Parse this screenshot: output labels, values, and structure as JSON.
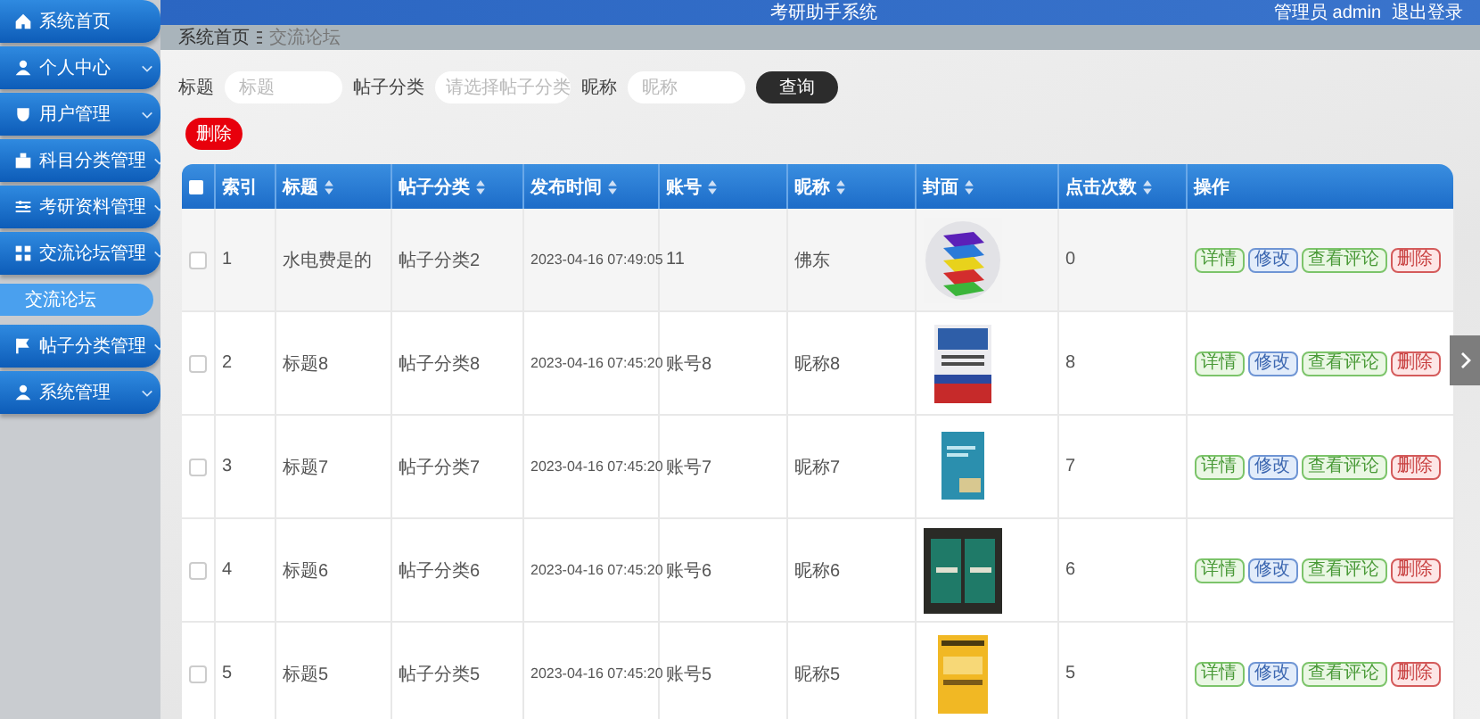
{
  "sidebar": {
    "items": [
      {
        "label": "系统首页",
        "kind": "link"
      },
      {
        "label": "个人中心",
        "kind": "menu"
      },
      {
        "label": "用户管理",
        "kind": "menu"
      },
      {
        "label": "科目分类管理",
        "kind": "menu"
      },
      {
        "label": "考研资料管理",
        "kind": "menu"
      },
      {
        "label": "交流论坛管理",
        "kind": "menu",
        "children": [
          {
            "label": "交流论坛",
            "selected": true
          }
        ]
      },
      {
        "label": "帖子分类管理",
        "kind": "menu"
      },
      {
        "label": "系统管理",
        "kind": "menu"
      }
    ]
  },
  "header": {
    "title": "考研助手系统",
    "user": "管理员 admin",
    "logout": "退出登录"
  },
  "breadcrumb": [
    "系统首页",
    "交流论坛"
  ],
  "search": {
    "fields": [
      {
        "label": "标题",
        "kind": "input",
        "placeholder": "标题"
      },
      {
        "label": "帖子分类",
        "kind": "select",
        "placeholder": "请选择帖子分类"
      },
      {
        "label": "昵称",
        "kind": "input",
        "placeholder": "昵称"
      }
    ],
    "button": "查询"
  },
  "delete_button": "删除",
  "table": {
    "header_checked": false,
    "columns": [
      {
        "label": "索引",
        "sortable": false
      },
      {
        "label": "标题",
        "sortable": true
      },
      {
        "label": "帖子分类",
        "sortable": true
      },
      {
        "label": "发布时间",
        "sortable": true
      },
      {
        "label": "账号",
        "sortable": true
      },
      {
        "label": "昵称",
        "sortable": true
      },
      {
        "label": "封面",
        "sortable": true
      },
      {
        "label": "点击次数",
        "sortable": true
      },
      {
        "label": "操作",
        "sortable": false
      }
    ],
    "rows": [
      {
        "checked": false,
        "index": "1",
        "title": "水电费是的",
        "category": "帖子分类2",
        "time": "2023-04-16 07:49:05",
        "account": "11",
        "nickname": "佛东",
        "cover": {
          "kind": "picture"
        },
        "clicks": "0",
        "actions": [
          {
            "label": "详情",
            "kind": "detail"
          },
          {
            "label": "修改",
            "kind": "edit"
          },
          {
            "label": "查看评论",
            "kind": "comments"
          },
          {
            "label": "删除",
            "kind": "delete"
          }
        ]
      },
      {
        "checked": false,
        "index": "2",
        "title": "标题8",
        "category": "帖子分类8",
        "time": "2023-04-16 07:45:20",
        "account": "账号8",
        "nickname": "昵称8",
        "cover": {
          "kind": "picture"
        },
        "clicks": "8",
        "actions": [
          {
            "label": "详情",
            "kind": "detail"
          },
          {
            "label": "修改",
            "kind": "edit"
          },
          {
            "label": "查看评论",
            "kind": "comments"
          },
          {
            "label": "删除",
            "kind": "delete"
          }
        ]
      },
      {
        "checked": false,
        "index": "3",
        "title": "标题7",
        "category": "帖子分类7",
        "time": "2023-04-16 07:45:20",
        "account": "账号7",
        "nickname": "昵称7",
        "cover": {
          "kind": "picture"
        },
        "clicks": "7",
        "actions": [
          {
            "label": "详情",
            "kind": "detail"
          },
          {
            "label": "修改",
            "kind": "edit"
          },
          {
            "label": "查看评论",
            "kind": "comments"
          },
          {
            "label": "删除",
            "kind": "delete"
          }
        ]
      },
      {
        "checked": false,
        "index": "4",
        "title": "标题6",
        "category": "帖子分类6",
        "time": "2023-04-16 07:45:20",
        "account": "账号6",
        "nickname": "昵称6",
        "cover": {
          "kind": "picture"
        },
        "clicks": "6",
        "actions": [
          {
            "label": "详情",
            "kind": "detail"
          },
          {
            "label": "修改",
            "kind": "edit"
          },
          {
            "label": "查看评论",
            "kind": "comments"
          },
          {
            "label": "删除",
            "kind": "delete"
          }
        ]
      },
      {
        "checked": false,
        "index": "5",
        "title": "标题5",
        "category": "帖子分类5",
        "time": "2023-04-16 07:45:20",
        "account": "账号5",
        "nickname": "昵称5",
        "cover": {
          "kind": "picture"
        },
        "clicks": "5",
        "actions": [
          {
            "label": "详情",
            "kind": "detail"
          },
          {
            "label": "修改",
            "kind": "edit"
          },
          {
            "label": "查看评论",
            "kind": "comments"
          },
          {
            "label": "删除",
            "kind": "delete"
          }
        ]
      }
    ]
  }
}
